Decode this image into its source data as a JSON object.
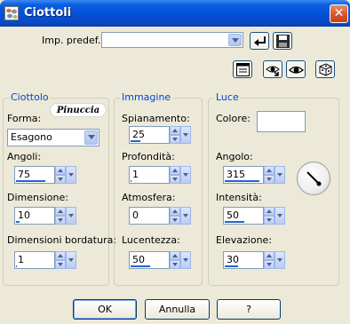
{
  "window": {
    "title": "Ciottoli"
  },
  "preset": {
    "label": "Imp. predef.:",
    "value": ""
  },
  "icons": {
    "app": "pebbles-app-icon",
    "close": "close-icon",
    "arrow": "run-arrow-icon",
    "save": "floppy-save-icon",
    "t1": "dialog-form-icon",
    "t2": "eye-arrow-icon",
    "t3": "eye-icon",
    "t4": "dice-icon"
  },
  "watermark": "Pinuccia",
  "groups": {
    "ciottolo": {
      "title": "Ciottolo",
      "shape_label": "Forma:",
      "shape_value": "Esagono",
      "angoli_label": "Angoli:",
      "angoli": "75",
      "angoli_fill": 0.75,
      "dimensione_label": "Dimensione:",
      "dimensione": "10",
      "dimensione_fill": 0.1,
      "bordatura_label": "Dimensioni bordatura:",
      "bordatura": "1",
      "bordatura_fill": 0.02
    },
    "immagine": {
      "title": "Immagine",
      "spianamento_label": "Spianamento:",
      "spianamento": "25",
      "spianamento_fill": 0.25,
      "profondita_label": "Profondità:",
      "profondita": "1",
      "profondita_fill": 0.02,
      "atmosfera_label": "Atmosfera:",
      "atmosfera": "0",
      "atmosfera_fill": 0.0,
      "lucentezza_label": "Lucentezza:",
      "lucentezza": "50",
      "lucentezza_fill": 0.5
    },
    "luce": {
      "title": "Luce",
      "colore_label": "Colore:",
      "colore": "#ffffff",
      "angolo_label": "Angolo:",
      "angolo": "315",
      "angolo_fill": 0.875,
      "intensita_label": "Intensità:",
      "intensita": "50",
      "intensita_fill": 0.5,
      "elevazione_label": "Elevazione:",
      "elevazione": "30",
      "elevazione_fill": 0.33
    }
  },
  "buttons": {
    "ok": "OK",
    "annulla": "Annulla",
    "help": "?"
  }
}
